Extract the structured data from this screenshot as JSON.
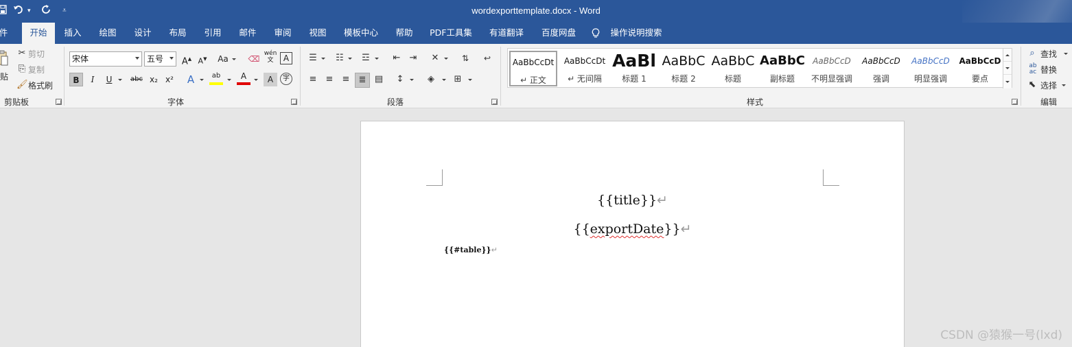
{
  "window": {
    "title": "wordexporttemplate.docx  -  Word"
  },
  "quick_access": {
    "save_icon": "save-icon",
    "undo_icon": "undo-icon",
    "redo_icon": "redo-icon",
    "customize_icon": "customize-icon"
  },
  "tabs": [
    {
      "label": "件"
    },
    {
      "label": "开始"
    },
    {
      "label": "插入"
    },
    {
      "label": "绘图"
    },
    {
      "label": "设计"
    },
    {
      "label": "布局"
    },
    {
      "label": "引用"
    },
    {
      "label": "邮件"
    },
    {
      "label": "审阅"
    },
    {
      "label": "视图"
    },
    {
      "label": "模板中心"
    },
    {
      "label": "帮助"
    },
    {
      "label": "PDF工具集"
    },
    {
      "label": "有道翻译"
    },
    {
      "label": "百度网盘"
    }
  ],
  "tell_me": {
    "label": "操作说明搜索"
  },
  "clipboard": {
    "paste_label": "贴",
    "cut_label": "剪切",
    "copy_label": "复制",
    "format_painter_label": "格式刷",
    "group_label": "剪贴板"
  },
  "font": {
    "font_name": "宋体",
    "font_size": "五号",
    "group_label": "字体",
    "grow_label": "A",
    "shrink_label": "A",
    "case_label": "Aa",
    "pinyin_label": "wén",
    "border_char_label": "A",
    "bold_label": "B",
    "italic_label": "I",
    "underline_label": "U",
    "strike_label": "abc",
    "subscript_label": "x₂",
    "superscript_label": "x²",
    "effects_label": "A",
    "highlight_label": "ab",
    "color_label": "A",
    "shading_label": "A",
    "enclose_label": "字"
  },
  "paragraph": {
    "group_label": "段落"
  },
  "styles": {
    "group_label": "样式",
    "items": [
      {
        "sample": "AaBbCcDt",
        "name": "↵ 正文"
      },
      {
        "sample": "AaBbCcDt",
        "name": "↵ 无间隔"
      },
      {
        "sample": "AaBl",
        "name": "标题 1"
      },
      {
        "sample": "AaBbC",
        "name": "标题 2"
      },
      {
        "sample": "AaBbC",
        "name": "标题"
      },
      {
        "sample": "AaBbC",
        "name": "副标题"
      },
      {
        "sample": "AaBbCcD",
        "name": "不明显强调"
      },
      {
        "sample": "AaBbCcD",
        "name": "强调"
      },
      {
        "sample": "AaBbCcD",
        "name": "明显强调"
      },
      {
        "sample": "AaBbCcD",
        "name": "要点"
      }
    ]
  },
  "editing": {
    "find_label": "查找",
    "replace_label": "替换",
    "select_label": "选择",
    "group_label": "编辑"
  },
  "document": {
    "line1": "{{title}}",
    "line2_prefix": "{{",
    "line2_word": "exportDate",
    "line2_suffix": "}}",
    "line3": "{{#table}}",
    "para_mark": "↵"
  },
  "watermark": "CSDN @猿猴一号(lxd)",
  "colors": {
    "titlebar": "#2b579a",
    "ribbon": "#f3f3f3",
    "highlight_yellow": "#ffff00",
    "font_red": "#e00000"
  }
}
